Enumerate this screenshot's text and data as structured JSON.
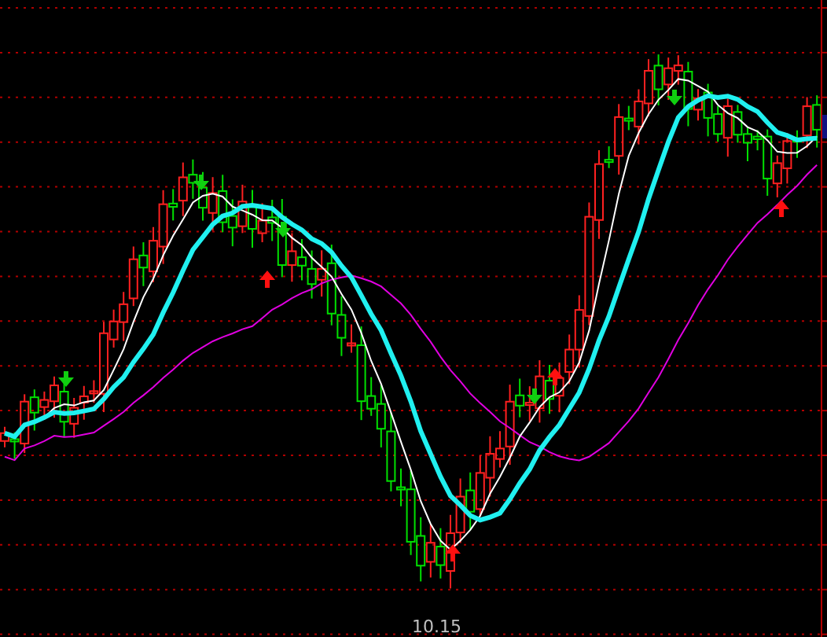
{
  "chart": {
    "bottom_label": "10.15"
  }
}
